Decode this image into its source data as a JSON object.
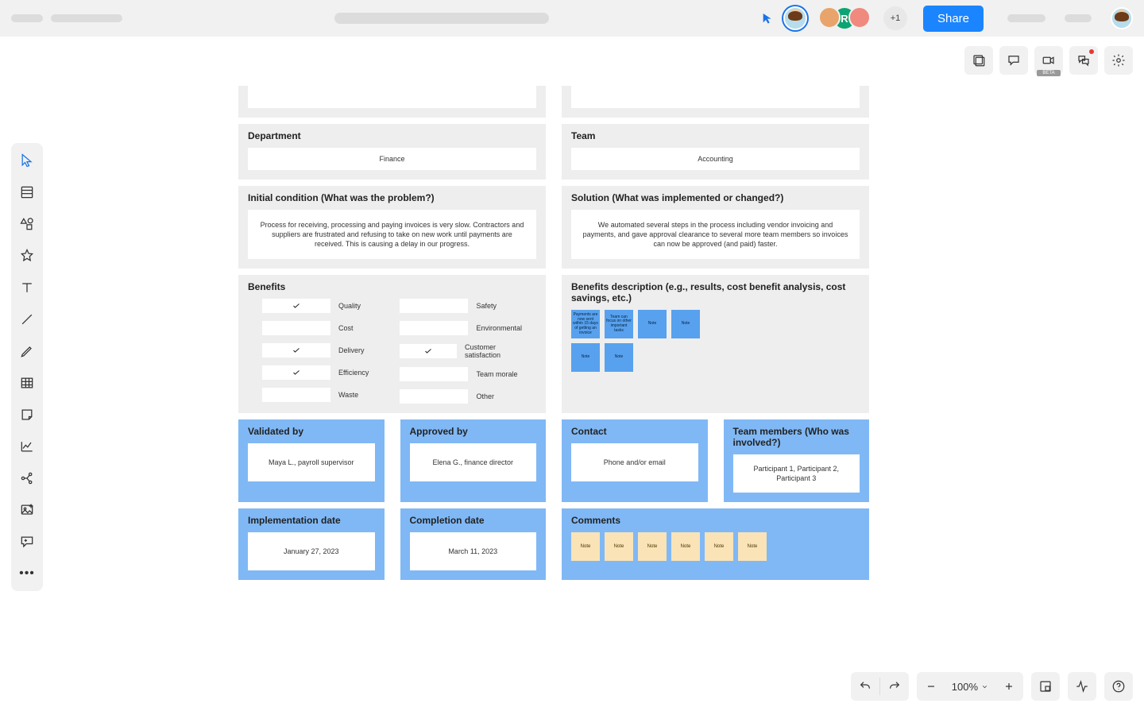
{
  "topbar": {
    "share_label": "Share",
    "overflow_count": "+1",
    "avatar_letter": "R"
  },
  "right_toolbar": {
    "beta_label": "BETA"
  },
  "zoom": {
    "level": "100%"
  },
  "frame": {
    "department": {
      "title": "Department",
      "value": "Finance"
    },
    "team": {
      "title": "Team",
      "value": "Accounting"
    },
    "initial_condition": {
      "title": "Initial condition (What was the problem?)",
      "value": "Process for receiving, processing and paying invoices is very slow. Contractors and suppliers are frustrated and refusing to take on new work until payments are received. This is causing a delay in our progress."
    },
    "solution": {
      "title": "Solution (What was implemented or changed?)",
      "value": "We automated several steps in the process including vendor invoicing and payments, and gave approval clearance to several more team members so invoices can now be approved (and paid) faster."
    },
    "benefits": {
      "title": "Benefits",
      "items_left": [
        {
          "label": "Quality",
          "checked": true
        },
        {
          "label": "Cost",
          "checked": false
        },
        {
          "label": "Delivery",
          "checked": true
        },
        {
          "label": "Efficiency",
          "checked": true
        },
        {
          "label": "Waste",
          "checked": false
        }
      ],
      "items_right": [
        {
          "label": "Safety",
          "checked": false
        },
        {
          "label": "Environmental",
          "checked": false
        },
        {
          "label": "Customer satisfaction",
          "checked": true
        },
        {
          "label": "Team morale",
          "checked": false
        },
        {
          "label": "Other",
          "checked": false
        }
      ]
    },
    "benefits_desc": {
      "title": "Benefits description (e.g., results, cost benefit analysis, cost savings, etc.)",
      "notes": [
        "Payments are now sent within 15 days of getting an invoice",
        "Team can focus on other important tasks",
        "Note",
        "Note",
        "Note",
        "Note"
      ]
    },
    "validated_by": {
      "title": "Validated by",
      "value": "Maya L., payroll supervisor"
    },
    "approved_by": {
      "title": "Approved by",
      "value": "Elena G., finance director"
    },
    "contact": {
      "title": "Contact",
      "value": "Phone and/or email"
    },
    "team_members": {
      "title": "Team members (Who was involved?)",
      "value": "Participant 1, Participant 2, Participant 3"
    },
    "impl_date": {
      "title": "Implementation date",
      "value": "January 27, 2023"
    },
    "comp_date": {
      "title": "Completion date",
      "value": "March 11, 2023"
    },
    "comments": {
      "title": "Comments",
      "notes": [
        "Note",
        "Note",
        "Note",
        "Note",
        "Note",
        "Note"
      ]
    }
  }
}
